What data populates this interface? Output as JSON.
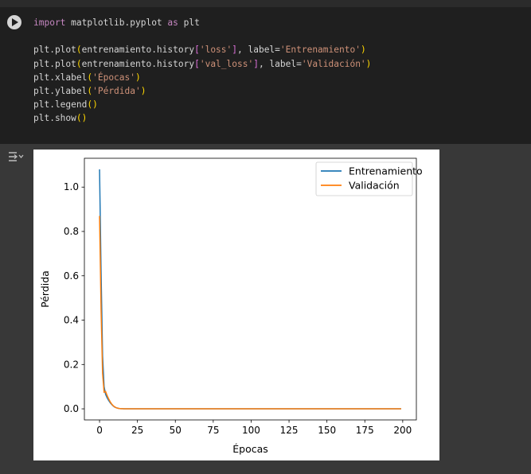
{
  "notebook": {
    "run_button_icon": "play-icon",
    "output_toggle_icon": "output-collapse-icon",
    "code_lines": [
      [
        {
          "t": "import",
          "c": "kw"
        },
        {
          "t": " matplotlib.pyplot ",
          "c": ""
        },
        {
          "t": "as",
          "c": "kw"
        },
        {
          "t": " plt",
          "c": ""
        }
      ],
      [],
      [
        {
          "t": "plt.plot",
          "c": ""
        },
        {
          "t": "(",
          "c": "p1"
        },
        {
          "t": "entrenamiento.history",
          "c": ""
        },
        {
          "t": "[",
          "c": "p2"
        },
        {
          "t": "'loss'",
          "c": "str"
        },
        {
          "t": "]",
          "c": "p2"
        },
        {
          "t": ", label=",
          "c": ""
        },
        {
          "t": "'Entrenamiento'",
          "c": "str"
        },
        {
          "t": ")",
          "c": "p1"
        }
      ],
      [
        {
          "t": "plt.plot",
          "c": ""
        },
        {
          "t": "(",
          "c": "p1"
        },
        {
          "t": "entrenamiento.history",
          "c": ""
        },
        {
          "t": "[",
          "c": "p2"
        },
        {
          "t": "'val_loss'",
          "c": "str"
        },
        {
          "t": "]",
          "c": "p2"
        },
        {
          "t": ", label=",
          "c": ""
        },
        {
          "t": "'Validación'",
          "c": "str"
        },
        {
          "t": ")",
          "c": "p1"
        }
      ],
      [
        {
          "t": "plt.xlabel",
          "c": ""
        },
        {
          "t": "(",
          "c": "p1"
        },
        {
          "t": "'Épocas'",
          "c": "str"
        },
        {
          "t": ")",
          "c": "p1"
        }
      ],
      [
        {
          "t": "plt.ylabel",
          "c": ""
        },
        {
          "t": "(",
          "c": "p1"
        },
        {
          "t": "'Pérdida'",
          "c": "str"
        },
        {
          "t": ")",
          "c": "p1"
        }
      ],
      [
        {
          "t": "plt.legend",
          "c": ""
        },
        {
          "t": "()",
          "c": "p1"
        }
      ],
      [
        {
          "t": "plt.show",
          "c": ""
        },
        {
          "t": "()",
          "c": "p1"
        }
      ]
    ]
  },
  "chart_data": {
    "type": "line",
    "xlabel": "Épocas",
    "ylabel": "Pérdida",
    "xlim": [
      -10,
      209
    ],
    "ylim": [
      -0.05,
      1.13
    ],
    "xticks": [
      0,
      25,
      50,
      75,
      100,
      125,
      150,
      175,
      200
    ],
    "yticks": [
      0.0,
      0.2,
      0.4,
      0.6,
      0.8,
      1.0
    ],
    "ytick_labels": [
      "0.0",
      "0.2",
      "0.4",
      "0.6",
      "0.8",
      "1.0"
    ],
    "legend_position": "top-right",
    "grid": false,
    "series": [
      {
        "name": "Entrenamiento",
        "color": "#1f77b4",
        "x": [
          0,
          1,
          2,
          3,
          4,
          5,
          6,
          7,
          8,
          9,
          10,
          11,
          12,
          13,
          14,
          15,
          16,
          18,
          20,
          25,
          50,
          100,
          150,
          199
        ],
        "y": [
          1.08,
          0.62,
          0.24,
          0.1,
          0.065,
          0.05,
          0.038,
          0.028,
          0.02,
          0.013,
          0.008,
          0.005,
          0.003,
          0.0015,
          0.0008,
          0.0005,
          0.0003,
          0.0002,
          0.0001,
          0.0001,
          0.0,
          0.0,
          0.0,
          0.0
        ]
      },
      {
        "name": "Validación",
        "color": "#ff7f0e",
        "x": [
          0,
          1,
          2,
          3,
          4,
          5,
          6,
          7,
          8,
          9,
          10,
          11,
          12,
          13,
          14,
          15,
          16,
          18,
          20,
          25,
          50,
          100,
          150,
          199
        ],
        "y": [
          0.87,
          0.45,
          0.16,
          0.075,
          0.078,
          0.06,
          0.045,
          0.032,
          0.022,
          0.014,
          0.009,
          0.005,
          0.003,
          0.0015,
          0.0008,
          0.0005,
          0.0003,
          0.0002,
          0.0001,
          0.0001,
          0.0,
          0.0,
          0.0,
          0.0
        ]
      }
    ]
  }
}
